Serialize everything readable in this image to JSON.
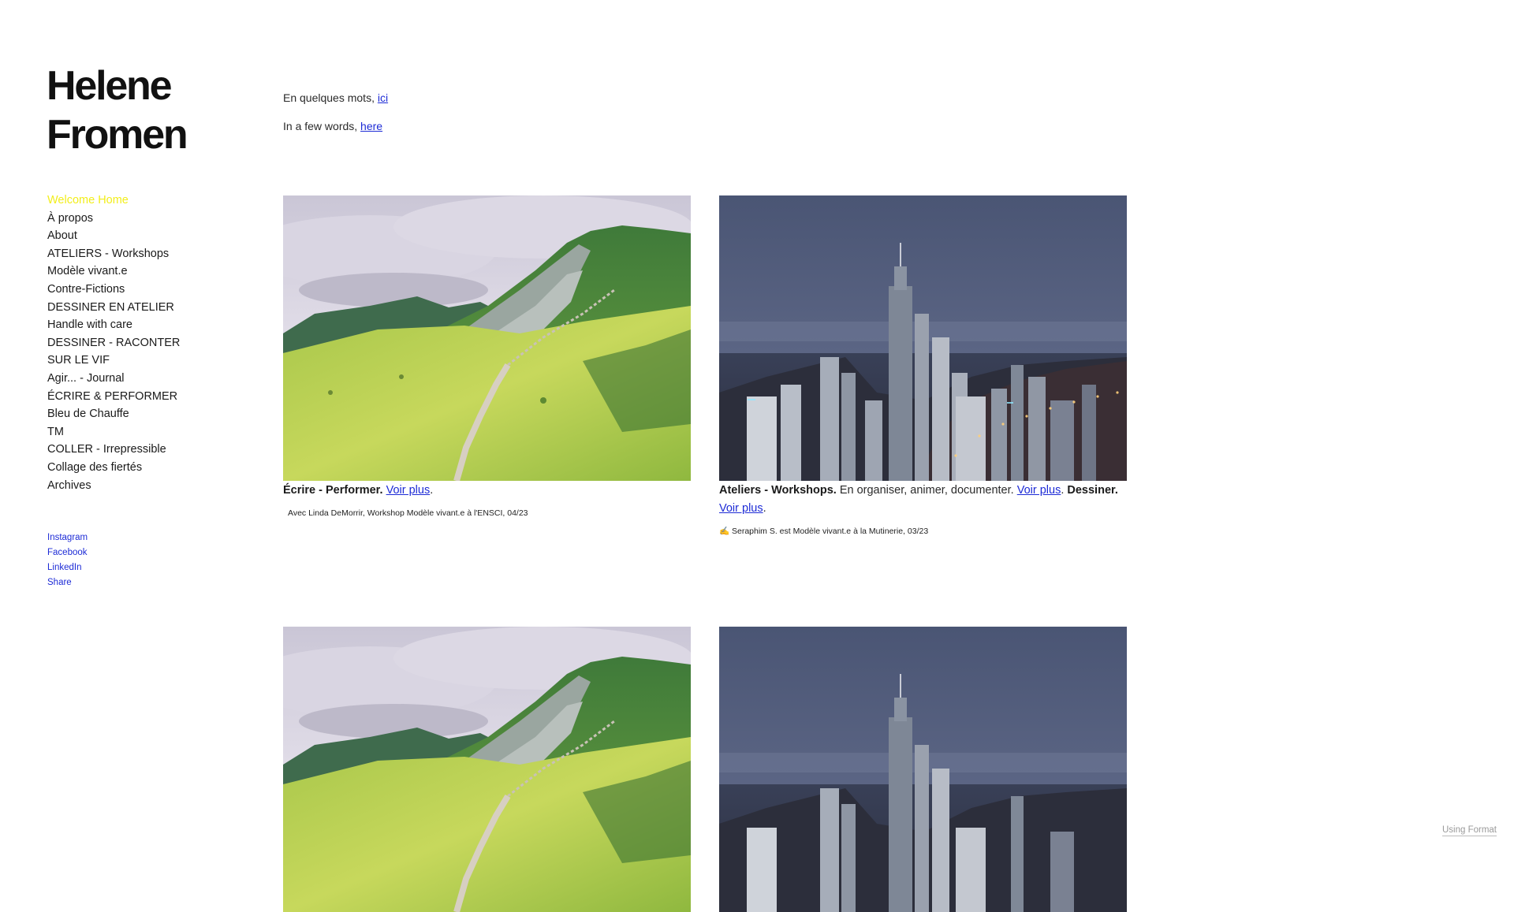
{
  "site": {
    "title_line1": "Helene",
    "title_line2": "Fromen"
  },
  "nav": {
    "items": [
      {
        "label": "Welcome Home",
        "active": true
      },
      {
        "label": "À propos"
      },
      {
        "label": "About"
      },
      {
        "label": "ATELIERS - Workshops"
      },
      {
        "label": "Modèle vivant.e"
      },
      {
        "label": "Contre-Fictions"
      },
      {
        "label": "DESSINER EN ATELIER"
      },
      {
        "label": "Handle with care"
      },
      {
        "label": "DESSINER - RACONTER"
      },
      {
        "label": "SUR LE VIF"
      },
      {
        "label": "Agir... - Journal"
      },
      {
        "label": "ÉCRIRE & PERFORMER"
      },
      {
        "label": "Bleu de Chauffe"
      },
      {
        "label": "TM"
      },
      {
        "label": "COLLER - Irrepressible"
      },
      {
        "label": "Collage des fiertés"
      },
      {
        "label": "Archives"
      }
    ]
  },
  "social": {
    "items": [
      "Instagram",
      "Facebook",
      "LinkedIn",
      "Share"
    ]
  },
  "intro": {
    "fr_text": "En quelques mots, ",
    "fr_link": "ici",
    "en_text": "In a few words, ",
    "en_link": "here"
  },
  "cards": [
    {
      "image": "mountain-landscape",
      "title": "Écrire - Performer.",
      "link": "Voir plus",
      "punct": ".",
      "credit": "Avec Linda DeMorrir, Workshop Modèle vivant.e à l'ENSCI, 04/23"
    },
    {
      "image": "city-skyline-dusk",
      "title": "Ateliers - Workshops.",
      "text": " En organiser, animer, documenter. ",
      "link": "Voir plus",
      "mid": ". ",
      "title2": "Dessiner.",
      "space": " ",
      "link2": "Voir plus",
      "punct": ".",
      "credit": "✍ Seraphim S. est Modèle vivant.e à la Mutinerie, 03/23"
    },
    {
      "image": "mountain-landscape"
    },
    {
      "image": "city-skyline-dusk"
    }
  ],
  "footer": {
    "badge": "Using Format"
  },
  "colors": {
    "accent_active": "#f2ee1b",
    "link": "#1d2bd6"
  }
}
